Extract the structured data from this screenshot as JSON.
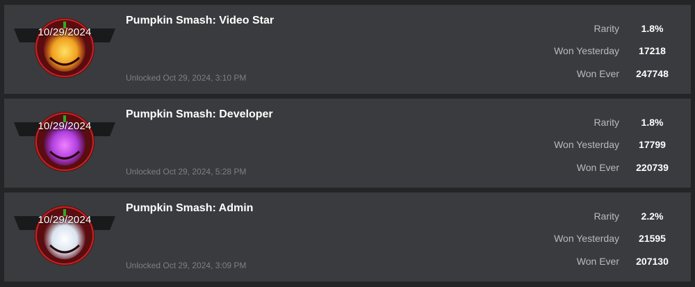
{
  "achievements": [
    {
      "date": "10/29/2024",
      "title": "Pumpkin Smash: Video Star",
      "unlocked": "Unlocked Oct 29, 2024, 3:10 PM",
      "stats": [
        {
          "label": "Rarity",
          "value": "1.8%"
        },
        {
          "label": "Won Yesterday",
          "value": "17218"
        },
        {
          "label": "Won Ever",
          "value": "247748"
        }
      ],
      "glow_color": "#f0a020"
    },
    {
      "date": "10/29/2024",
      "title": "Pumpkin Smash: Developer",
      "unlocked": "Unlocked Oct 29, 2024, 5:28 PM",
      "stats": [
        {
          "label": "Rarity",
          "value": "1.8%"
        },
        {
          "label": "Won Yesterday",
          "value": "17799"
        },
        {
          "label": "Won Ever",
          "value": "220739"
        }
      ],
      "glow_color": "#b040e0"
    },
    {
      "date": "10/29/2024",
      "title": "Pumpkin Smash: Admin",
      "unlocked": "Unlocked Oct 29, 2024, 3:09 PM",
      "stats": [
        {
          "label": "Rarity",
          "value": "2.2%"
        },
        {
          "label": "Won Yesterday",
          "value": "21595"
        },
        {
          "label": "Won Ever",
          "value": "207130"
        }
      ],
      "glow_color": "#d8e4f0"
    }
  ]
}
